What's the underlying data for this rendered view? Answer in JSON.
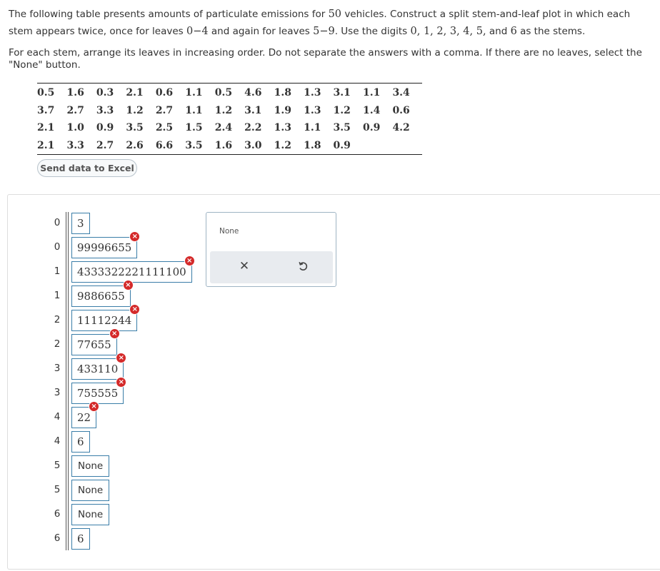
{
  "prompt": {
    "p1_a": "The following table presents amounts of particulate emissions for ",
    "p1_n": "50",
    "p1_b": " vehicles. Construct a split stem-and-leaf plot in which each stem appears twice, once for leaves ",
    "p1_r1": "0−4",
    "p1_c": " and again for leaves ",
    "p1_r2": "5−9",
    "p1_d": ". Use the digits ",
    "p1_digits": "0, 1, 2, 3, 4, 5,",
    "p1_e": " and ",
    "p1_six": "6",
    "p1_f": " as the stems.",
    "p2": "For each stem, arrange its leaves in increasing order. Do not separate the answers with a comma. If there are no leaves, select the \"None\" button."
  },
  "table": {
    "rows": [
      [
        "0.5",
        "1.6",
        "0.3",
        "2.1",
        "0.6",
        "1.1",
        "0.5",
        "4.6",
        "1.8",
        "1.3",
        "3.1",
        "1.1",
        "3.4"
      ],
      [
        "3.7",
        "2.7",
        "3.3",
        "1.2",
        "2.7",
        "1.1",
        "1.2",
        "3.1",
        "1.9",
        "1.3",
        "1.2",
        "1.4",
        "0.6"
      ],
      [
        "2.1",
        "1.0",
        "0.9",
        "3.5",
        "2.5",
        "1.5",
        "2.4",
        "2.2",
        "1.3",
        "1.1",
        "3.5",
        "0.9",
        "4.2"
      ],
      [
        "2.1",
        "3.3",
        "2.7",
        "2.6",
        "6.6",
        "3.5",
        "1.6",
        "3.0",
        "1.2",
        "1.8",
        "0.9",
        "",
        ""
      ]
    ]
  },
  "excel_button": "Send data to Excel",
  "plot": {
    "rows": [
      {
        "stem": "0",
        "leaves": "3",
        "error": false
      },
      {
        "stem": "0",
        "leaves": "99996655",
        "error": true
      },
      {
        "stem": "1",
        "leaves": "4333322221111100",
        "error": true
      },
      {
        "stem": "1",
        "leaves": "9886655",
        "error": true
      },
      {
        "stem": "2",
        "leaves": "11112244",
        "error": true
      },
      {
        "stem": "2",
        "leaves": "77655",
        "error": true
      },
      {
        "stem": "3",
        "leaves": "433110",
        "error": true
      },
      {
        "stem": "3",
        "leaves": "755555",
        "error": true
      },
      {
        "stem": "4",
        "leaves": "22",
        "error": true
      },
      {
        "stem": "4",
        "leaves": "6",
        "error": false
      },
      {
        "stem": "5",
        "leaves": "None",
        "error": false
      },
      {
        "stem": "5",
        "leaves": "None",
        "error": false
      },
      {
        "stem": "6",
        "leaves": "None",
        "error": false
      },
      {
        "stem": "6",
        "leaves": "6",
        "error": false
      }
    ]
  },
  "tools": {
    "none_label": "None",
    "clear_icon": "close-icon",
    "undo_icon": "undo-icon"
  },
  "colors": {
    "input_border": "#3a7da8",
    "error": "#d42a2a"
  }
}
